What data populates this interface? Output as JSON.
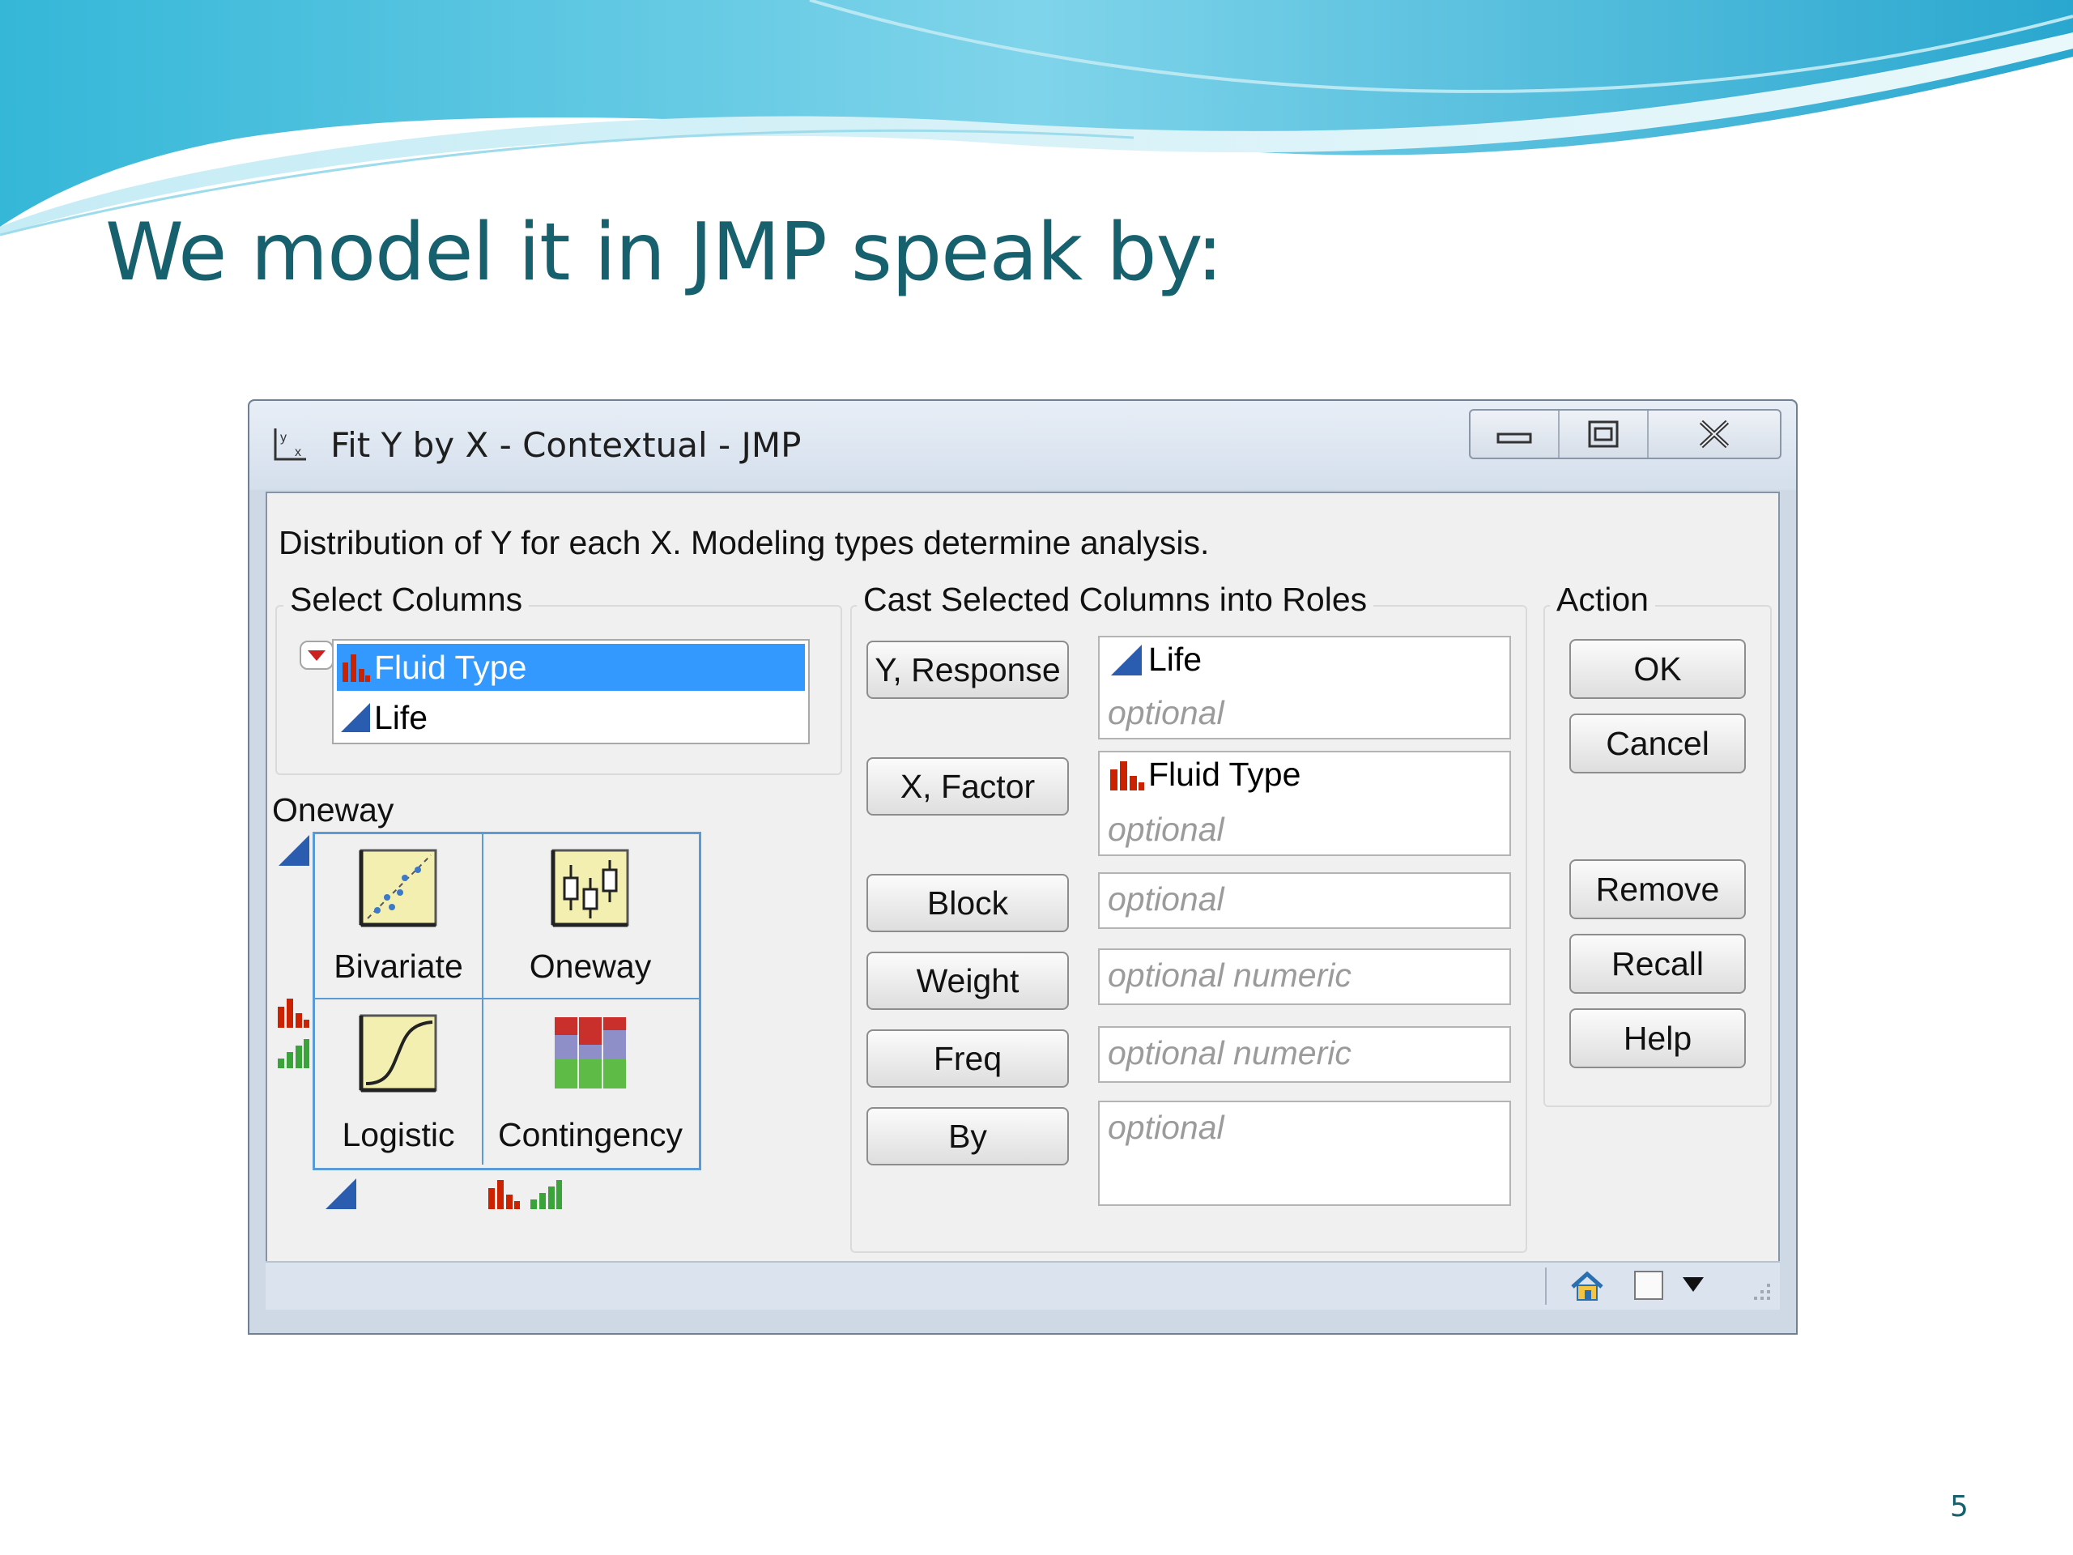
{
  "slide": {
    "title": "We model it in JMP speak by:",
    "page_number": "5"
  },
  "window": {
    "title": "Fit Y by X - Contextual - JMP",
    "icons": [
      "fit-y-by-x-icon",
      "minimize-icon",
      "restore-icon",
      "close-icon"
    ]
  },
  "dialog": {
    "description": "Distribution of Y for each X. Modeling types determine analysis.",
    "select_columns": {
      "label": "Select Columns",
      "items": [
        {
          "label": "Fluid Type",
          "type": "nominal",
          "selected": true
        },
        {
          "label": "Life",
          "type": "continuous",
          "selected": false
        }
      ]
    },
    "oneway_label": "Oneway",
    "analysis_grid": [
      {
        "label": "Bivariate",
        "icon": "bivariate-icon"
      },
      {
        "label": "Oneway",
        "icon": "oneway-icon"
      },
      {
        "label": "Logistic",
        "icon": "logistic-icon"
      },
      {
        "label": "Contingency",
        "icon": "contingency-icon"
      }
    ],
    "roles": {
      "label": "Cast Selected Columns into Roles",
      "y_response": {
        "button": "Y, Response",
        "value": "Life",
        "placeholder": "optional"
      },
      "x_factor": {
        "button": "X, Factor",
        "value": "Fluid Type",
        "placeholder": "optional"
      },
      "block": {
        "button": "Block",
        "placeholder": "optional"
      },
      "weight": {
        "button": "Weight",
        "placeholder": "optional numeric"
      },
      "freq": {
        "button": "Freq",
        "placeholder": "optional numeric"
      },
      "by": {
        "button": "By",
        "placeholder": "optional"
      }
    },
    "action": {
      "label": "Action",
      "ok": "OK",
      "cancel": "Cancel",
      "remove": "Remove",
      "recall": "Recall",
      "help": "Help"
    }
  },
  "colors": {
    "title_teal": "#17606e",
    "selection_blue": "#3399ff",
    "grid_border": "#5b9bd5",
    "nominal_red": "#cc2200",
    "continuous_blue": "#2a5db0",
    "ordinal_green": "#3aa33a"
  }
}
